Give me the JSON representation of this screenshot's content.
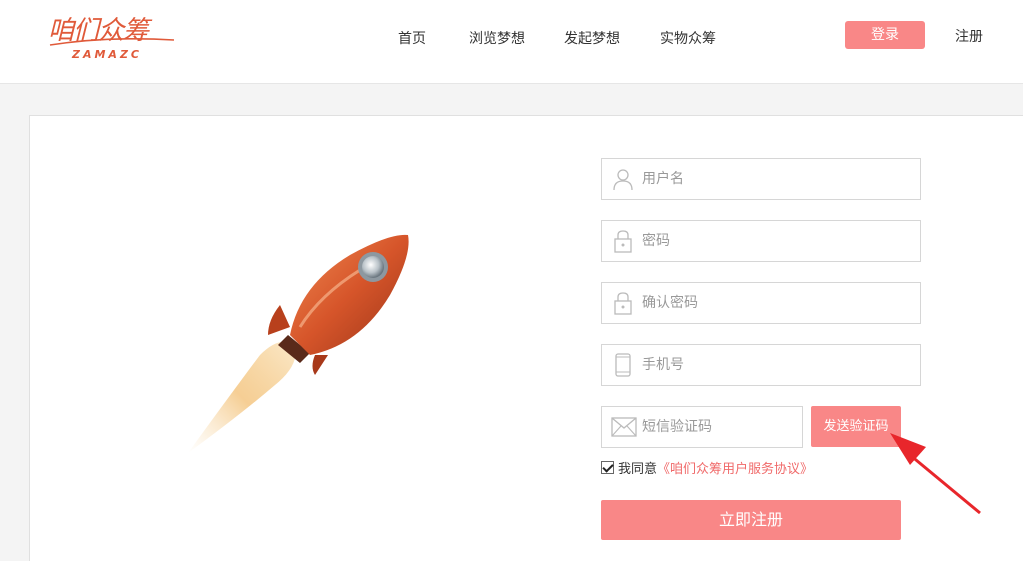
{
  "logo": {
    "name_cn": "咱们众筹",
    "name_en": "ZAMAZC"
  },
  "nav": {
    "items": [
      {
        "label": "首页"
      },
      {
        "label": "浏览梦想"
      },
      {
        "label": "发起梦想"
      },
      {
        "label": "实物众筹"
      }
    ],
    "login_label": "登录",
    "register_label": "注册"
  },
  "form": {
    "username_placeholder": "用户名",
    "password_placeholder": "密码",
    "confirm_password_placeholder": "确认密码",
    "phone_placeholder": "手机号",
    "sms_code_placeholder": "短信验证码",
    "send_code_label": "发送验证码",
    "agree_text": "我同意",
    "agreement_link": "《咱们众筹用户服务协议》",
    "agree_checked": true,
    "submit_label": "立即注册"
  },
  "colors": {
    "accent": "#f98787",
    "brand": "#e05a3a",
    "link": "#f06a6a",
    "annotation_arrow": "#e8262b"
  },
  "icons": [
    "user-icon",
    "lock-icon",
    "lock-icon",
    "phone-icon",
    "mail-icon",
    "rocket-illustration",
    "red-arrow-annotation"
  ]
}
